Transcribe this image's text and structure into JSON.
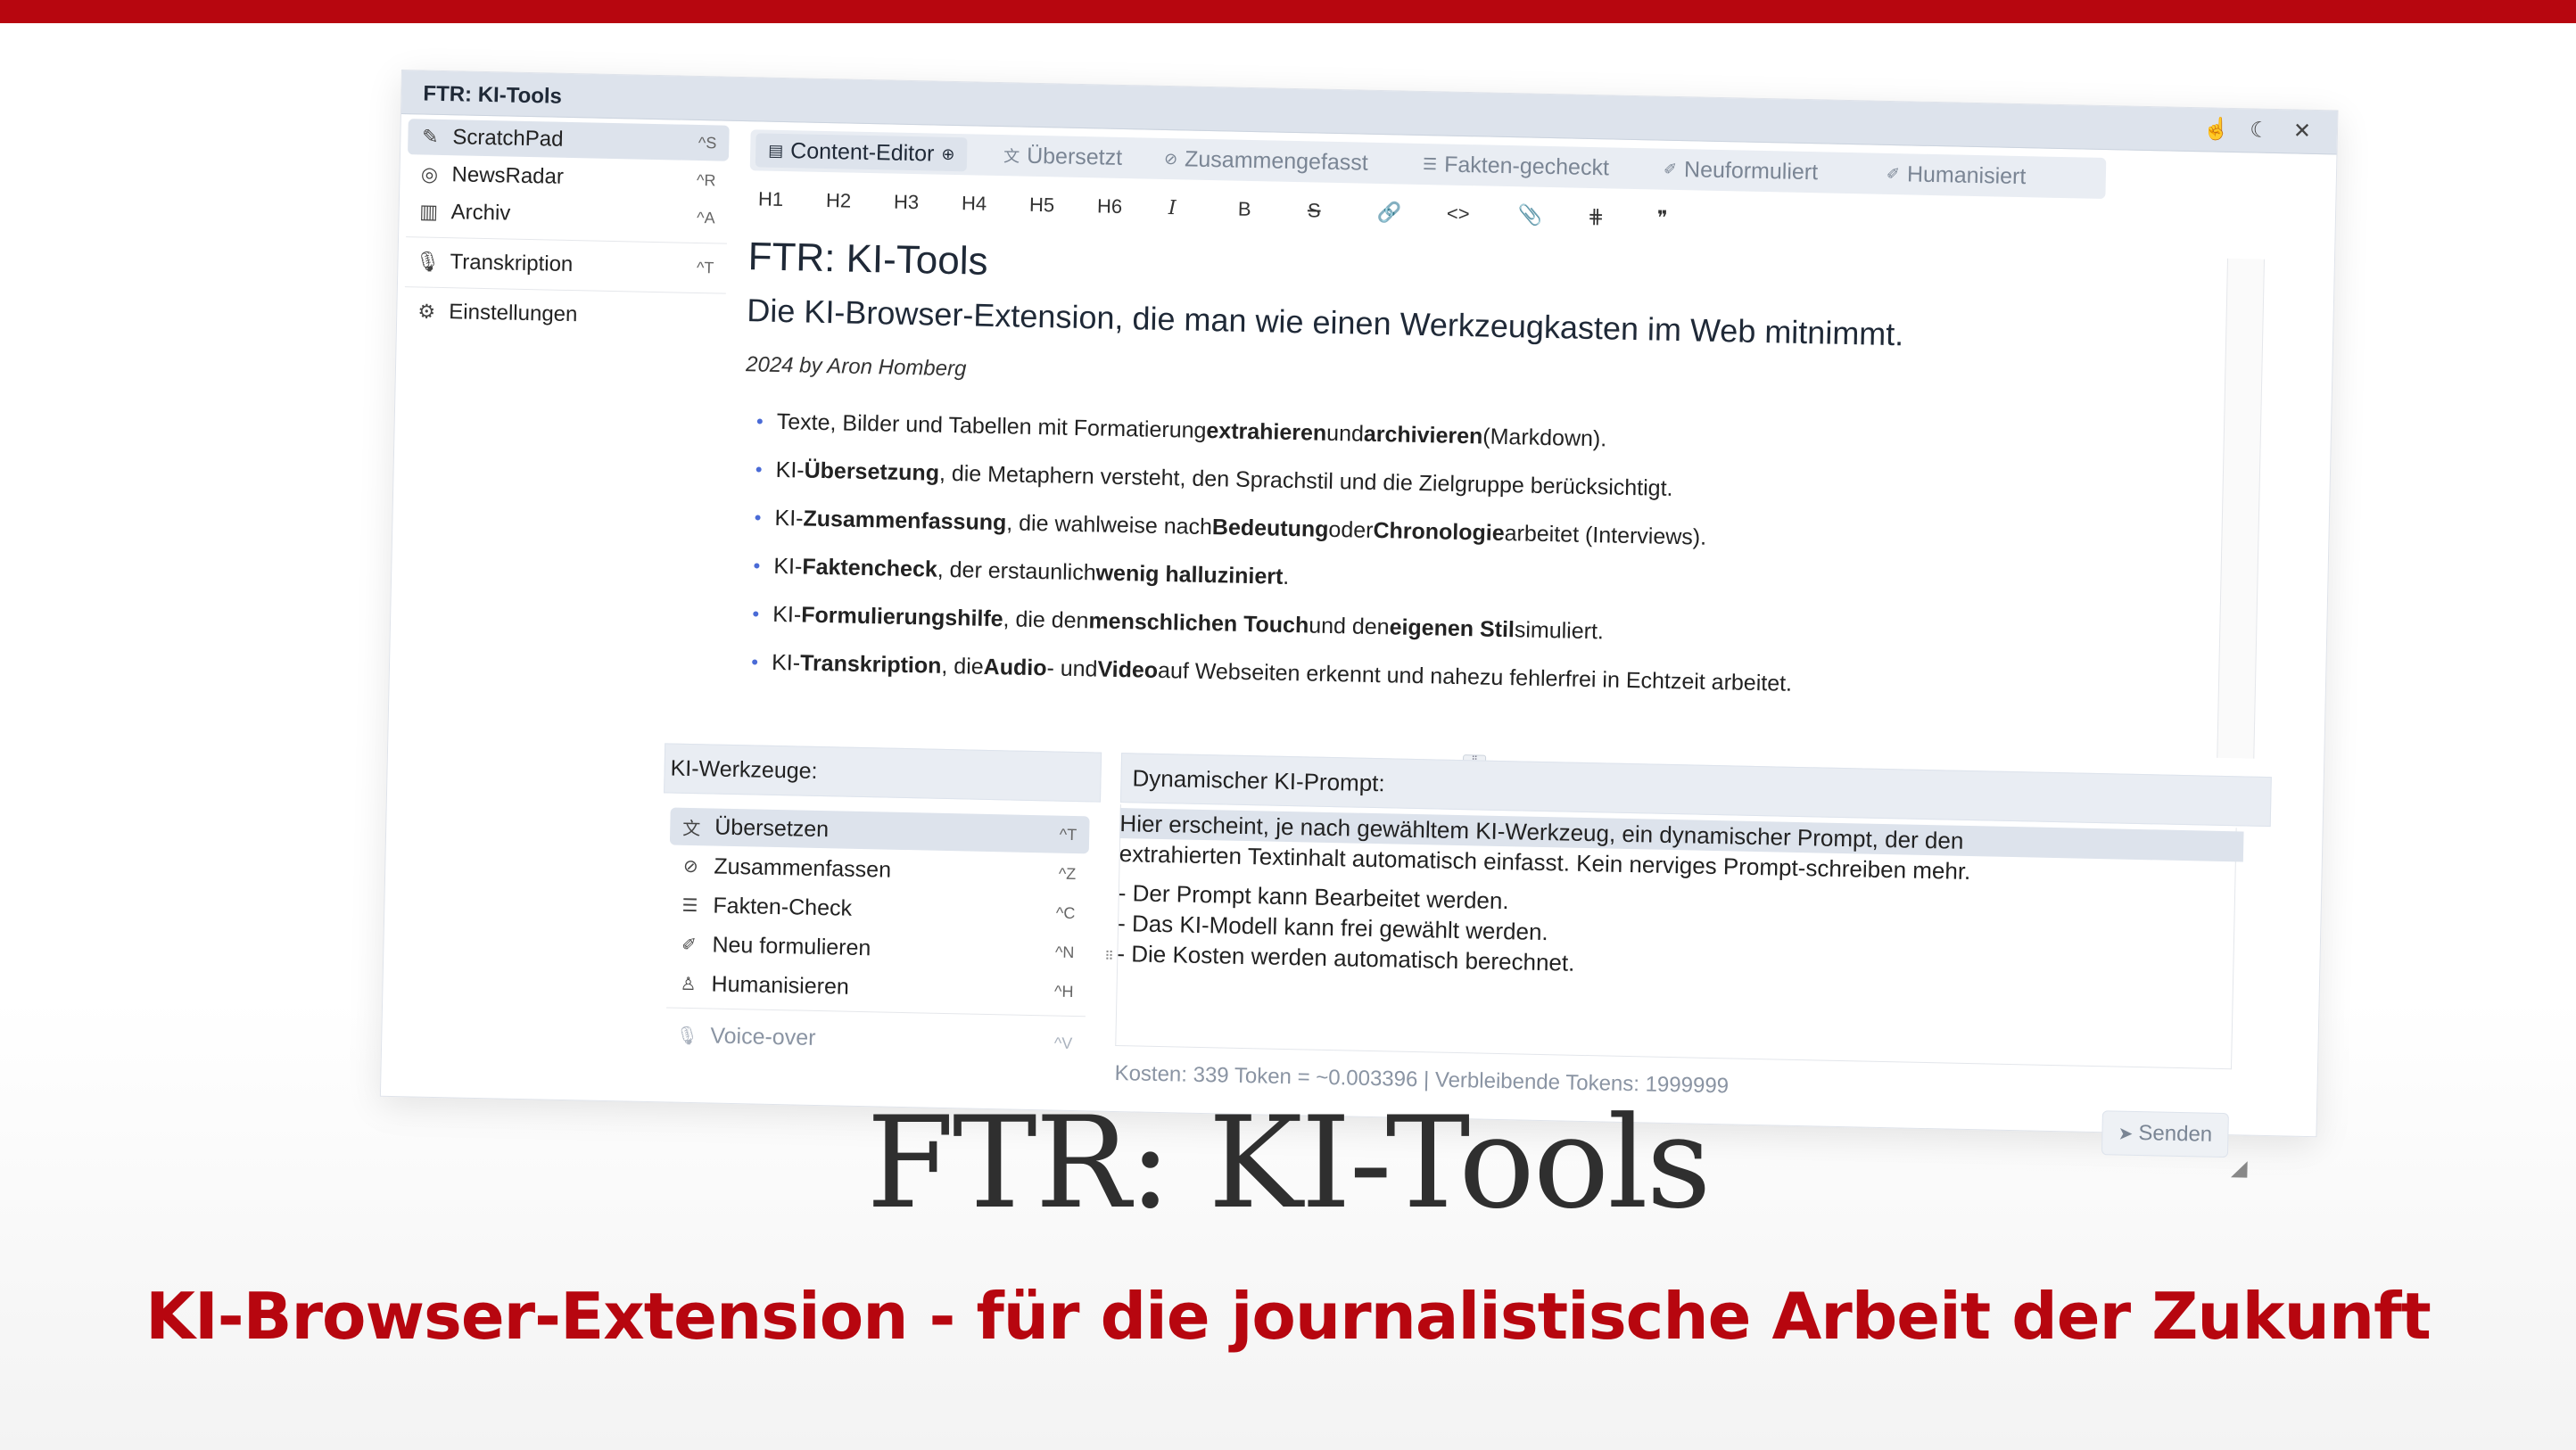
{
  "window": {
    "title": "FTR: KI-Tools",
    "controls": [
      {
        "icon": "hand-pointer-icon",
        "glyph": "☝"
      },
      {
        "icon": "moon-icon",
        "glyph": "☾"
      },
      {
        "icon": "close-icon",
        "glyph": "✕"
      }
    ]
  },
  "sidebar": {
    "items": [
      {
        "label": "ScratchPad",
        "key": "^S",
        "icon": "edit-icon",
        "glyph": "✎",
        "active": true
      },
      {
        "label": "NewsRadar",
        "key": "^R",
        "icon": "radar-icon",
        "glyph": "◎"
      },
      {
        "label": "Archiv",
        "key": "^A",
        "icon": "library-icon",
        "glyph": "▥"
      },
      {
        "label": "Transkription",
        "key": "^T",
        "icon": "microphone-icon",
        "glyph": "🎙"
      },
      {
        "label": "Einstellungen",
        "key": "",
        "icon": "gear-icon",
        "glyph": "⚙"
      }
    ]
  },
  "tabs": [
    {
      "label": "Content-Editor",
      "icon": "document-icon",
      "glyph": "▤",
      "suffix": "⊕",
      "active": true
    },
    {
      "label": "Übersetzt",
      "icon": "translate-icon",
      "glyph": "文"
    },
    {
      "label": "Zusammengefasst",
      "icon": "compass-icon",
      "glyph": "⊘"
    },
    {
      "label": "Fakten-gecheckt",
      "icon": "list-icon",
      "glyph": "☰"
    },
    {
      "label": "Neuformuliert",
      "icon": "pen-icon",
      "glyph": "✐"
    },
    {
      "label": "Humanisiert",
      "icon": "pen-icon",
      "glyph": "✐"
    }
  ],
  "format_toolbar": [
    "H1",
    "H2",
    "H3",
    "H4",
    "H5",
    "H6",
    "I",
    "B",
    "S",
    "🔗",
    "<>",
    "📎",
    "⋕",
    "❞"
  ],
  "editor": {
    "h1": "FTR: KI-Tools",
    "h2": "Die KI-Browser-Extension, die man wie einen Werkzeugkasten im Web mitnimmt.",
    "byline": "2024 by Aron Homberg",
    "bullets": [
      {
        "parts": [
          {
            "t": "Texte, Bilder und Tabellen mit Formatierung "
          },
          {
            "t": "extrahieren",
            "b": true
          },
          {
            "t": " und "
          },
          {
            "t": "archivieren",
            "b": true
          },
          {
            "t": " (Markdown)."
          }
        ]
      },
      {
        "parts": [
          {
            "t": "KI-"
          },
          {
            "t": "Übersetzung",
            "b": true
          },
          {
            "t": ", die Metaphern versteht, den Sprachstil und die Zielgruppe berücksichtigt."
          }
        ]
      },
      {
        "parts": [
          {
            "t": "KI-"
          },
          {
            "t": "Zusammenfassung",
            "b": true
          },
          {
            "t": ", die wahlweise nach "
          },
          {
            "t": "Bedeutung",
            "b": true
          },
          {
            "t": " oder "
          },
          {
            "t": "Chronologie",
            "b": true
          },
          {
            "t": " arbeitet (Interviews)."
          }
        ]
      },
      {
        "parts": [
          {
            "t": "KI-"
          },
          {
            "t": "Faktencheck",
            "b": true
          },
          {
            "t": ", der erstaunlich "
          },
          {
            "t": "wenig halluziniert",
            "b": true
          },
          {
            "t": "."
          }
        ]
      },
      {
        "parts": [
          {
            "t": "KI-"
          },
          {
            "t": "Formulierungshilfe",
            "b": true
          },
          {
            "t": ", die den "
          },
          {
            "t": "menschlichen Touch",
            "b": true
          },
          {
            "t": " und den "
          },
          {
            "t": "eigenen Stil",
            "b": true
          },
          {
            "t": " simuliert."
          }
        ]
      },
      {
        "parts": [
          {
            "t": "KI-"
          },
          {
            "t": "Transkription",
            "b": true
          },
          {
            "t": ", die "
          },
          {
            "t": "Audio",
            "b": true
          },
          {
            "t": "- und "
          },
          {
            "t": "Video",
            "b": true
          },
          {
            "t": " auf Webseiten erkennt und nahezu fehlerfrei in Echtzeit arbeitet."
          }
        ]
      }
    ]
  },
  "tools": {
    "heading": "KI-Werkzeuge:",
    "items": [
      {
        "label": "Übersetzen",
        "key": "^T",
        "icon": "translate-icon",
        "glyph": "文",
        "active": true
      },
      {
        "label": "Zusammenfassen",
        "key": "^Z",
        "icon": "compass-icon",
        "glyph": "⊘"
      },
      {
        "label": "Fakten-Check",
        "key": "^C",
        "icon": "list-icon",
        "glyph": "☰"
      },
      {
        "label": "Neu formulieren",
        "key": "^N",
        "icon": "pen-icon",
        "glyph": "✐"
      },
      {
        "label": "Humanisieren",
        "key": "^H",
        "icon": "person-icon",
        "glyph": "♙"
      },
      {
        "label": "Voice-over",
        "key": "^V",
        "icon": "microphone-icon",
        "glyph": "🎙",
        "muted": true
      }
    ]
  },
  "prompt": {
    "heading": "Dynamischer KI-Prompt:",
    "line1": "Hier erscheint, je nach gewähltem KI-Werkzeug, ein dynamischer Prompt, der den",
    "line2": "extrahierten Textinhalt automatisch einfasst. Kein nerviges Prompt-schreiben mehr.",
    "line3": "- Der Prompt kann Bearbeitet werden.",
    "line4": "- Das KI-Modell kann frei gewählt werden.",
    "line5": "- Die Kosten werden automatisch berechnet.",
    "cost": "Kosten: 339 Token = ~0.003396 | Verbleibende Tokens: 1999999",
    "send_label": "Senden"
  },
  "overlay": {
    "title": "FTR: KI-Tools",
    "subtitle": "KI-Browser-Extension - für die journalistische Arbeit der Zukunft"
  },
  "colors": {
    "accent_red": "#b7060f",
    "panel_gray": "#dde3ec"
  }
}
